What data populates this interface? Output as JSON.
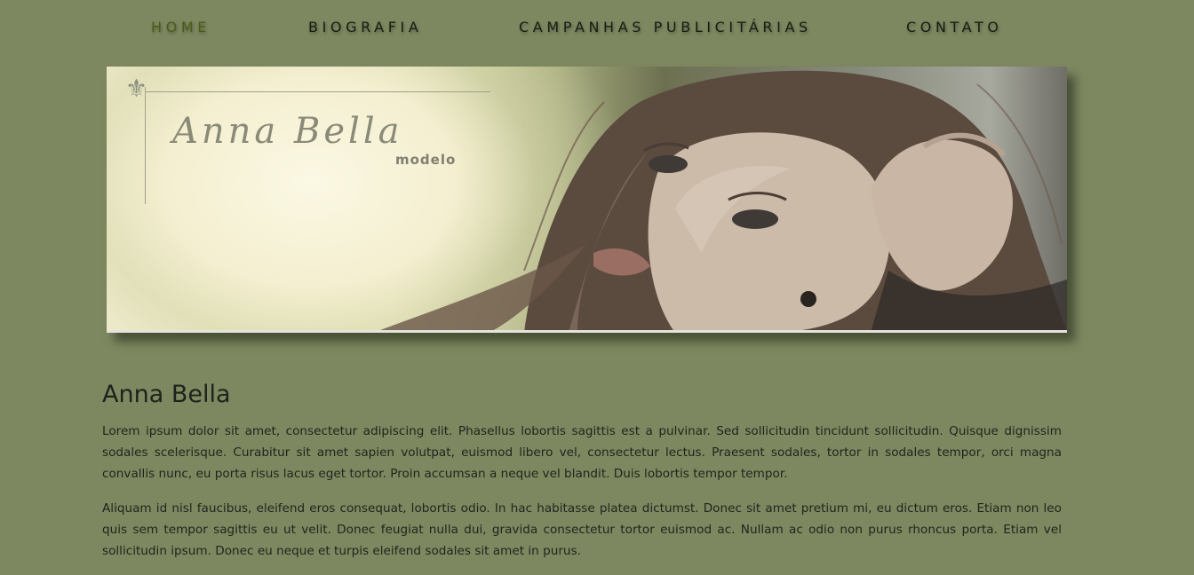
{
  "nav": {
    "items": [
      {
        "label": "HOME",
        "active": true
      },
      {
        "label": "BIOGRAFIA",
        "active": false
      },
      {
        "label": "CAMPANHAS PUBLICITÁRIAS",
        "active": false
      },
      {
        "label": "CONTATO",
        "active": false
      }
    ]
  },
  "banner": {
    "logo_icon": "fleur-de-lis-icon",
    "logo_title": "Anna Bella",
    "logo_subtitle": "modelo"
  },
  "main": {
    "heading": "Anna Bella",
    "paragraphs": [
      "Lorem ipsum dolor sit amet, consectetur adipiscing elit. Phasellus lobortis sagittis est a pulvinar. Sed sollicitudin tincidunt sollicitudin. Quisque dignissim sodales scelerisque. Curabitur sit amet sapien volutpat, euismod libero vel, consectetur lectus. Praesent sodales, tortor in sodales tempor, orci magna convallis nunc, eu porta risus lacus eget tortor. Proin accumsan a neque vel blandit. Duis lobortis tempor tempor.",
      "Aliquam id nisl faucibus, eleifend eros consequat, lobortis odio. In hac habitasse platea dictumst. Donec sit amet pretium mi, eu dictum eros. Etiam non leo quis sem tempor sagittis eu ut velit. Donec feugiat nulla dui, gravida consectetur tortor euismod ac. Nullam ac odio non purus rhoncus porta. Etiam vel sollicitudin ipsum. Donec eu neque et turpis eleifend sodales sit amet in purus."
    ]
  },
  "colors": {
    "background": "#7d8860",
    "nav_active": "#4f5a18",
    "text": "#1f241c"
  }
}
